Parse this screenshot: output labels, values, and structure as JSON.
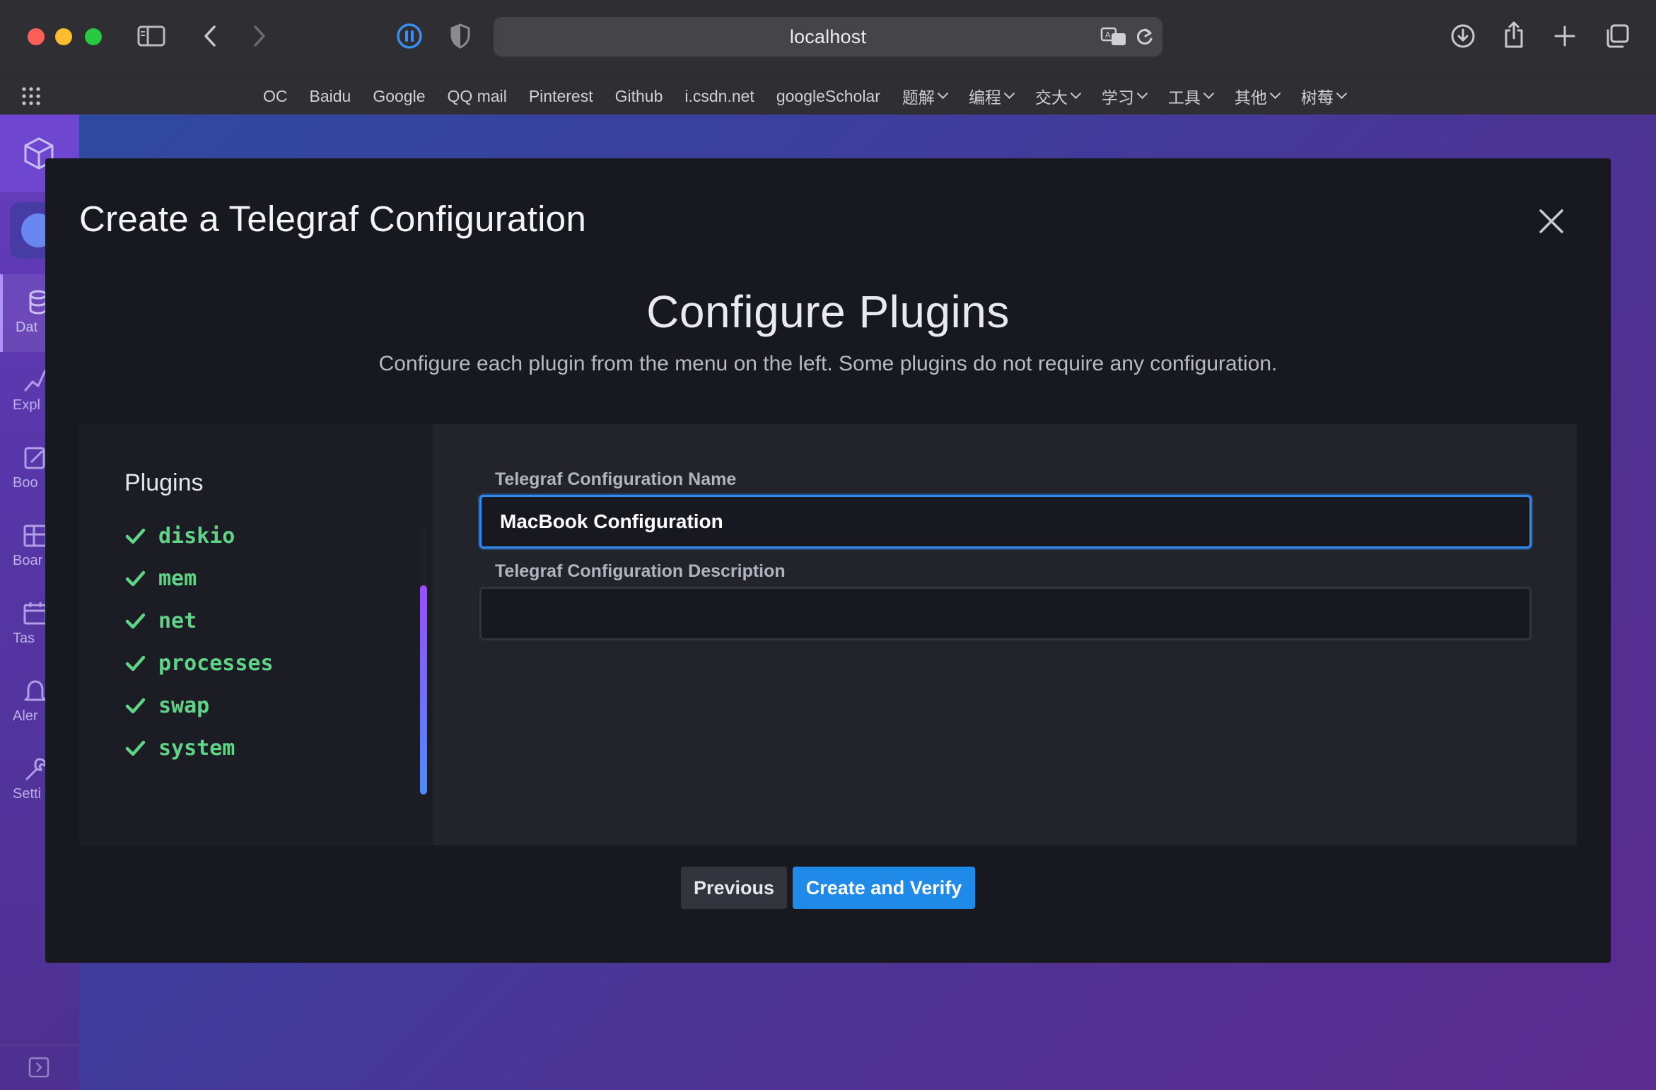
{
  "browser": {
    "url": "localhost",
    "bookmarks": [
      {
        "label": "OC"
      },
      {
        "label": "Baidu"
      },
      {
        "label": "Google"
      },
      {
        "label": "QQ mail"
      },
      {
        "label": "Pinterest"
      },
      {
        "label": "Github"
      },
      {
        "label": "i.csdn.net"
      },
      {
        "label": "googleScholar"
      },
      {
        "label": "题解"
      },
      {
        "label": "编程"
      },
      {
        "label": "交大"
      },
      {
        "label": "学习"
      },
      {
        "label": "工具"
      },
      {
        "label": "其他"
      },
      {
        "label": "树莓"
      }
    ]
  },
  "sidenav": {
    "items": [
      {
        "label": "Dat",
        "icon": "database-icon"
      },
      {
        "label": "Expl",
        "icon": "explore-icon"
      },
      {
        "label": "Boo",
        "icon": "notebook-icon"
      },
      {
        "label": "Boar",
        "icon": "dashboard-icon"
      },
      {
        "label": "Tas",
        "icon": "calendar-icon"
      },
      {
        "label": "Aler",
        "icon": "bell-icon"
      },
      {
        "label": "Setti",
        "icon": "wrench-icon"
      }
    ]
  },
  "modal": {
    "title": "Create a Telegraf Configuration",
    "step_title": "Configure Plugins",
    "step_subtitle": "Configure each plugin from the menu on the left. Some plugins do not require any configuration.",
    "plugins_heading": "Plugins",
    "plugins": [
      {
        "name": "diskio",
        "configured": true
      },
      {
        "name": "mem",
        "configured": true
      },
      {
        "name": "net",
        "configured": true
      },
      {
        "name": "processes",
        "configured": true
      },
      {
        "name": "swap",
        "configured": true
      },
      {
        "name": "system",
        "configured": true
      }
    ],
    "name_label": "Telegraf Configuration Name",
    "name_value": "MacBook Configuration",
    "description_label": "Telegraf Configuration Description",
    "description_value": "",
    "previous_label": "Previous",
    "create_label": "Create and Verify"
  },
  "colors": {
    "accent": "#1f8ae8",
    "plugin_text": "#5fd487",
    "modal_bg": "#181820"
  }
}
